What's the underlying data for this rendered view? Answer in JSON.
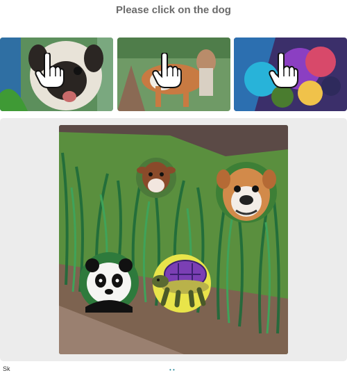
{
  "prompt": "Please click on the dog",
  "examples": [
    {
      "subject": "dog",
      "icon": "pointer-hand-icon"
    },
    {
      "subject": "dog",
      "icon": "pointer-hand-icon"
    },
    {
      "subject": "dog",
      "icon": "pointer-hand-icon"
    }
  ],
  "scene": {
    "animals": [
      "cow",
      "dog",
      "panda",
      "turtle"
    ]
  },
  "footer": {
    "left_text": "Sk",
    "dots": "• •"
  },
  "colors": {
    "board": "#ececec",
    "prompt": "#6b6b6b",
    "grass": "#2f8a43",
    "dirt": "#7a5a48"
  }
}
